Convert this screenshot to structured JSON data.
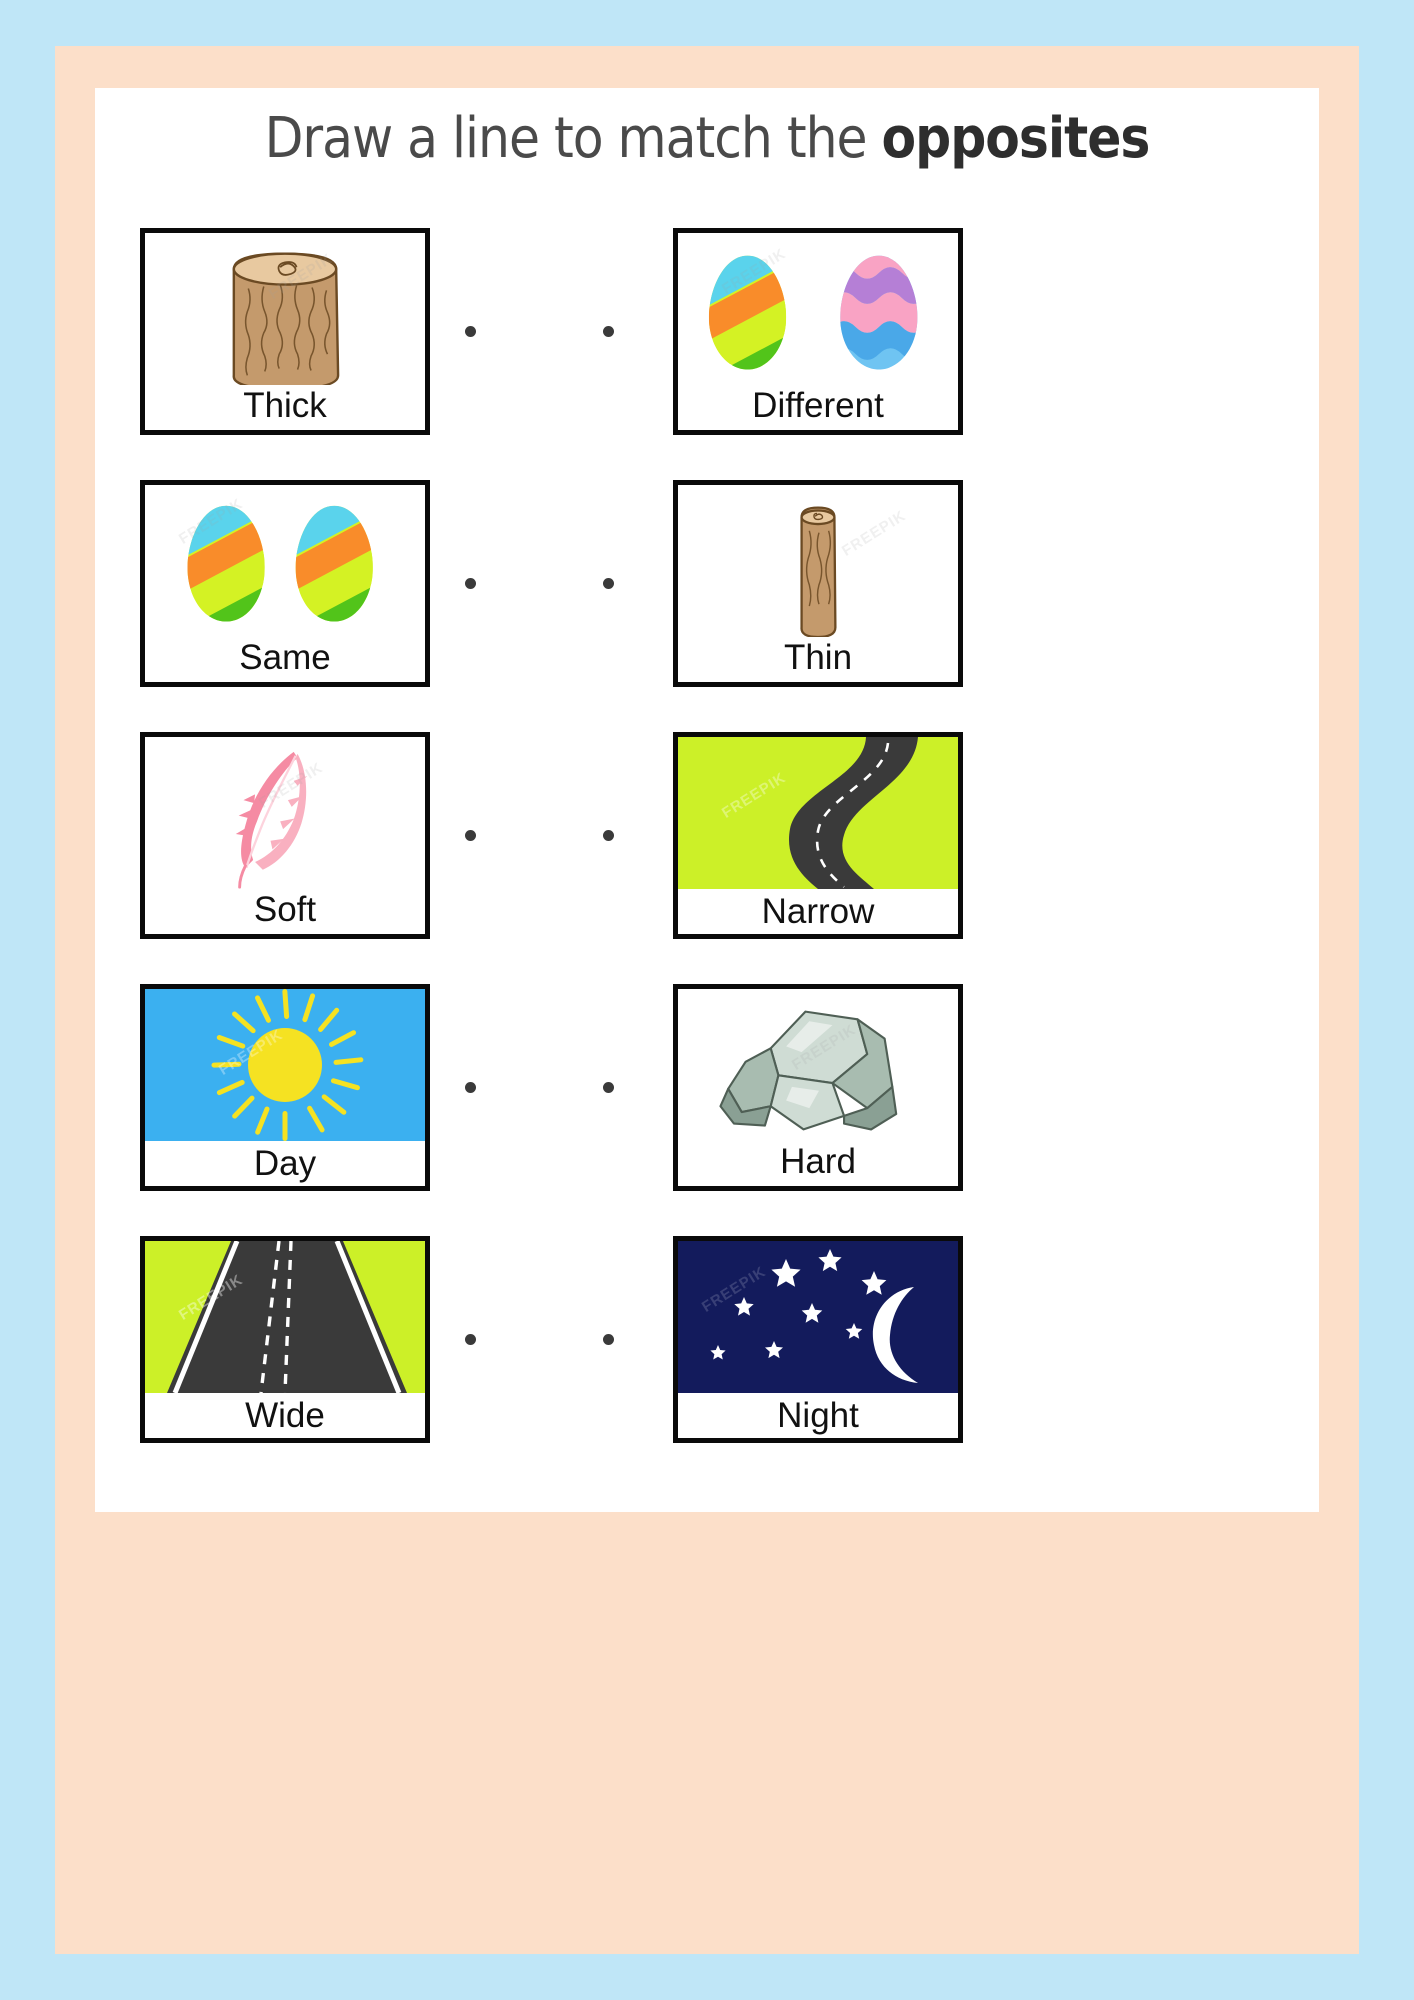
{
  "worksheet": {
    "title_plain": "Draw a line to match the ",
    "title_bold": "opposites",
    "instruction_full": "Draw a line to match the opposites"
  },
  "colors": {
    "outer_background": "#bfe6f7",
    "frame": "#fcdfc9",
    "sheet": "#ffffff",
    "card_border": "#0a0a0a",
    "label_text": "#111111",
    "title_text": "#4a4a4a",
    "dot": "#3a3a3a",
    "log_body": "#c49a6c",
    "log_top": "#e8c9a0",
    "log_outline": "#6b4a23",
    "egg_red": "#f03c18",
    "egg_cyan": "#5ad3ec",
    "egg_orange": "#f98c2a",
    "egg_lime": "#d4f224",
    "egg_green": "#52c41a",
    "egg_pink": "#f9a3c4",
    "egg_blue": "#4aa8e8",
    "egg_purple": "#b57fd6",
    "feather_pink": "#f58ba3",
    "feather_pink_light": "#f9b0c0",
    "sky_day": "#3bb0f0",
    "sun_yellow": "#f5e222",
    "sky_night": "#131b5c",
    "star_white": "#ffffff",
    "grass_green": "#ccf028",
    "asphalt": "#3a3a3a",
    "road_line": "#ffffff",
    "rock_light": "#cfdcd4",
    "rock_mid": "#a8bcb0",
    "rock_dark": "#8aa094"
  },
  "rows": [
    {
      "left": {
        "label": "Thick",
        "art": "thick-log",
        "art_style": "contain"
      },
      "right": {
        "label": "Different",
        "art": "two-different-eggs",
        "art_style": "contain"
      }
    },
    {
      "left": {
        "label": "Same",
        "art": "two-same-eggs",
        "art_style": "contain"
      },
      "right": {
        "label": "Thin",
        "art": "thin-log",
        "art_style": "contain"
      }
    },
    {
      "left": {
        "label": "Soft",
        "art": "feather",
        "art_style": "contain"
      },
      "right": {
        "label": "Narrow",
        "art": "narrow-road",
        "art_style": "bleed"
      }
    },
    {
      "left": {
        "label": "Day",
        "art": "sun-sky",
        "art_style": "bleed"
      },
      "right": {
        "label": "Hard",
        "art": "rocks",
        "art_style": "contain"
      }
    },
    {
      "left": {
        "label": "Wide",
        "art": "wide-road",
        "art_style": "bleed"
      },
      "right": {
        "label": "Night",
        "art": "moon-stars",
        "art_style": "bleed"
      }
    }
  ],
  "connectors": {
    "count_per_row": 2,
    "note": "left dot and right dot, unconnected"
  },
  "watermark": {
    "text": "FREEPIK"
  }
}
